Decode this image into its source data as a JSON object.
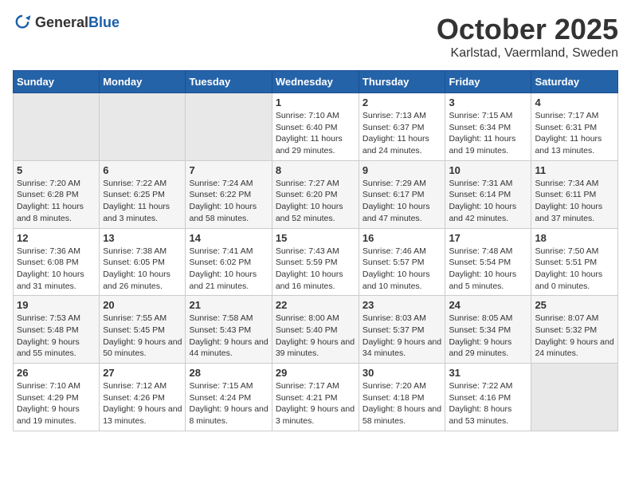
{
  "header": {
    "logo_general": "General",
    "logo_blue": "Blue",
    "month_title": "October 2025",
    "location": "Karlstad, Vaermland, Sweden"
  },
  "weekdays": [
    "Sunday",
    "Monday",
    "Tuesday",
    "Wednesday",
    "Thursday",
    "Friday",
    "Saturday"
  ],
  "weeks": [
    [
      {
        "day": "",
        "sunrise": "",
        "sunset": "",
        "daylight": ""
      },
      {
        "day": "",
        "sunrise": "",
        "sunset": "",
        "daylight": ""
      },
      {
        "day": "",
        "sunrise": "",
        "sunset": "",
        "daylight": ""
      },
      {
        "day": "1",
        "sunrise": "Sunrise: 7:10 AM",
        "sunset": "Sunset: 6:40 PM",
        "daylight": "Daylight: 11 hours and 29 minutes."
      },
      {
        "day": "2",
        "sunrise": "Sunrise: 7:13 AM",
        "sunset": "Sunset: 6:37 PM",
        "daylight": "Daylight: 11 hours and 24 minutes."
      },
      {
        "day": "3",
        "sunrise": "Sunrise: 7:15 AM",
        "sunset": "Sunset: 6:34 PM",
        "daylight": "Daylight: 11 hours and 19 minutes."
      },
      {
        "day": "4",
        "sunrise": "Sunrise: 7:17 AM",
        "sunset": "Sunset: 6:31 PM",
        "daylight": "Daylight: 11 hours and 13 minutes."
      }
    ],
    [
      {
        "day": "5",
        "sunrise": "Sunrise: 7:20 AM",
        "sunset": "Sunset: 6:28 PM",
        "daylight": "Daylight: 11 hours and 8 minutes."
      },
      {
        "day": "6",
        "sunrise": "Sunrise: 7:22 AM",
        "sunset": "Sunset: 6:25 PM",
        "daylight": "Daylight: 11 hours and 3 minutes."
      },
      {
        "day": "7",
        "sunrise": "Sunrise: 7:24 AM",
        "sunset": "Sunset: 6:22 PM",
        "daylight": "Daylight: 10 hours and 58 minutes."
      },
      {
        "day": "8",
        "sunrise": "Sunrise: 7:27 AM",
        "sunset": "Sunset: 6:20 PM",
        "daylight": "Daylight: 10 hours and 52 minutes."
      },
      {
        "day": "9",
        "sunrise": "Sunrise: 7:29 AM",
        "sunset": "Sunset: 6:17 PM",
        "daylight": "Daylight: 10 hours and 47 minutes."
      },
      {
        "day": "10",
        "sunrise": "Sunrise: 7:31 AM",
        "sunset": "Sunset: 6:14 PM",
        "daylight": "Daylight: 10 hours and 42 minutes."
      },
      {
        "day": "11",
        "sunrise": "Sunrise: 7:34 AM",
        "sunset": "Sunset: 6:11 PM",
        "daylight": "Daylight: 10 hours and 37 minutes."
      }
    ],
    [
      {
        "day": "12",
        "sunrise": "Sunrise: 7:36 AM",
        "sunset": "Sunset: 6:08 PM",
        "daylight": "Daylight: 10 hours and 31 minutes."
      },
      {
        "day": "13",
        "sunrise": "Sunrise: 7:38 AM",
        "sunset": "Sunset: 6:05 PM",
        "daylight": "Daylight: 10 hours and 26 minutes."
      },
      {
        "day": "14",
        "sunrise": "Sunrise: 7:41 AM",
        "sunset": "Sunset: 6:02 PM",
        "daylight": "Daylight: 10 hours and 21 minutes."
      },
      {
        "day": "15",
        "sunrise": "Sunrise: 7:43 AM",
        "sunset": "Sunset: 5:59 PM",
        "daylight": "Daylight: 10 hours and 16 minutes."
      },
      {
        "day": "16",
        "sunrise": "Sunrise: 7:46 AM",
        "sunset": "Sunset: 5:57 PM",
        "daylight": "Daylight: 10 hours and 10 minutes."
      },
      {
        "day": "17",
        "sunrise": "Sunrise: 7:48 AM",
        "sunset": "Sunset: 5:54 PM",
        "daylight": "Daylight: 10 hours and 5 minutes."
      },
      {
        "day": "18",
        "sunrise": "Sunrise: 7:50 AM",
        "sunset": "Sunset: 5:51 PM",
        "daylight": "Daylight: 10 hours and 0 minutes."
      }
    ],
    [
      {
        "day": "19",
        "sunrise": "Sunrise: 7:53 AM",
        "sunset": "Sunset: 5:48 PM",
        "daylight": "Daylight: 9 hours and 55 minutes."
      },
      {
        "day": "20",
        "sunrise": "Sunrise: 7:55 AM",
        "sunset": "Sunset: 5:45 PM",
        "daylight": "Daylight: 9 hours and 50 minutes."
      },
      {
        "day": "21",
        "sunrise": "Sunrise: 7:58 AM",
        "sunset": "Sunset: 5:43 PM",
        "daylight": "Daylight: 9 hours and 44 minutes."
      },
      {
        "day": "22",
        "sunrise": "Sunrise: 8:00 AM",
        "sunset": "Sunset: 5:40 PM",
        "daylight": "Daylight: 9 hours and 39 minutes."
      },
      {
        "day": "23",
        "sunrise": "Sunrise: 8:03 AM",
        "sunset": "Sunset: 5:37 PM",
        "daylight": "Daylight: 9 hours and 34 minutes."
      },
      {
        "day": "24",
        "sunrise": "Sunrise: 8:05 AM",
        "sunset": "Sunset: 5:34 PM",
        "daylight": "Daylight: 9 hours and 29 minutes."
      },
      {
        "day": "25",
        "sunrise": "Sunrise: 8:07 AM",
        "sunset": "Sunset: 5:32 PM",
        "daylight": "Daylight: 9 hours and 24 minutes."
      }
    ],
    [
      {
        "day": "26",
        "sunrise": "Sunrise: 7:10 AM",
        "sunset": "Sunset: 4:29 PM",
        "daylight": "Daylight: 9 hours and 19 minutes."
      },
      {
        "day": "27",
        "sunrise": "Sunrise: 7:12 AM",
        "sunset": "Sunset: 4:26 PM",
        "daylight": "Daylight: 9 hours and 13 minutes."
      },
      {
        "day": "28",
        "sunrise": "Sunrise: 7:15 AM",
        "sunset": "Sunset: 4:24 PM",
        "daylight": "Daylight: 9 hours and 8 minutes."
      },
      {
        "day": "29",
        "sunrise": "Sunrise: 7:17 AM",
        "sunset": "Sunset: 4:21 PM",
        "daylight": "Daylight: 9 hours and 3 minutes."
      },
      {
        "day": "30",
        "sunrise": "Sunrise: 7:20 AM",
        "sunset": "Sunset: 4:18 PM",
        "daylight": "Daylight: 8 hours and 58 minutes."
      },
      {
        "day": "31",
        "sunrise": "Sunrise: 7:22 AM",
        "sunset": "Sunset: 4:16 PM",
        "daylight": "Daylight: 8 hours and 53 minutes."
      },
      {
        "day": "",
        "sunrise": "",
        "sunset": "",
        "daylight": ""
      }
    ]
  ]
}
